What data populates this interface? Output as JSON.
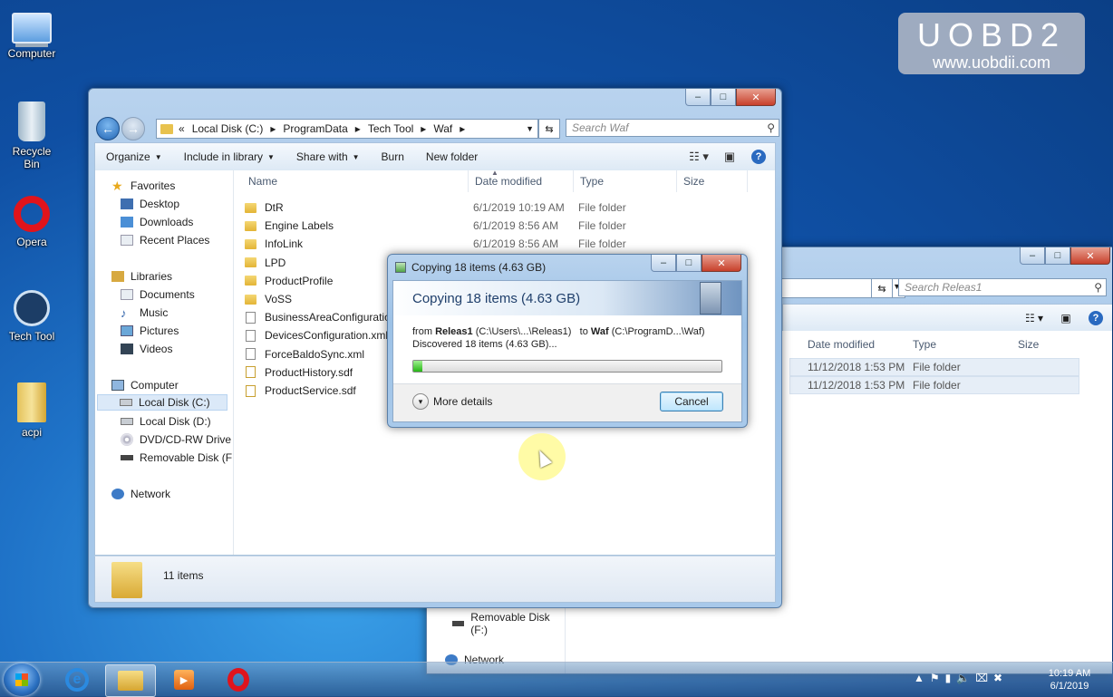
{
  "watermark": {
    "title": "UOBD2",
    "url": "www.uobdii.com"
  },
  "desktop": {
    "icons": [
      "Computer",
      "Recycle Bin",
      "Opera",
      "Tech Tool",
      "acpi"
    ]
  },
  "main_window": {
    "caption_buttons": [
      "–",
      "□",
      "✕"
    ],
    "breadcrumb": [
      "«",
      "Local Disk (C:)",
      "ProgramData",
      "Tech Tool",
      "Waf"
    ],
    "search_placeholder": "Search Waf",
    "toolbar": {
      "organize": "Organize",
      "include": "Include in library",
      "share": "Share with",
      "burn": "Burn",
      "new_folder": "New folder"
    },
    "nav": {
      "favorites": "Favorites",
      "desktop": "Desktop",
      "downloads": "Downloads",
      "recent": "Recent Places",
      "libraries": "Libraries",
      "documents": "Documents",
      "music": "Music",
      "pictures": "Pictures",
      "videos": "Videos",
      "computer": "Computer",
      "local_c": "Local Disk (C:)",
      "local_d": "Local Disk (D:)",
      "dvd": "DVD/CD-RW Drive (",
      "removable": "Removable Disk (F:)",
      "network": "Network"
    },
    "columns": {
      "name": "Name",
      "date": "Date modified",
      "type": "Type",
      "size": "Size"
    },
    "files": [
      {
        "name": "DtR",
        "date": "6/1/2019 10:19 AM",
        "type": "File folder",
        "kind": "folder"
      },
      {
        "name": "Engine Labels",
        "date": "6/1/2019 8:56 AM",
        "type": "File folder",
        "kind": "folder"
      },
      {
        "name": "InfoLink",
        "date": "6/1/2019 8:56 AM",
        "type": "File folder",
        "kind": "folder"
      },
      {
        "name": "LPD",
        "date": "",
        "type": "",
        "kind": "folder"
      },
      {
        "name": "ProductProfile",
        "date": "",
        "type": "",
        "kind": "folder"
      },
      {
        "name": "VoSS",
        "date": "",
        "type": "",
        "kind": "folder"
      },
      {
        "name": "BusinessAreaConfiguration",
        "date": "",
        "type": "",
        "kind": "file"
      },
      {
        "name": "DevicesConfiguration.xml",
        "date": "",
        "type": "",
        "kind": "file"
      },
      {
        "name": "ForceBaldoSync.xml",
        "date": "",
        "type": "",
        "kind": "file"
      },
      {
        "name": "ProductHistory.sdf",
        "date": "",
        "type": "",
        "kind": "sdf"
      },
      {
        "name": "ProductService.sdf",
        "date": "",
        "type": "",
        "kind": "sdf"
      }
    ],
    "status": "11 items"
  },
  "background_window": {
    "search_placeholder": "Search Releas1",
    "columns": {
      "date": "Date modified",
      "type": "Type",
      "size": "Size"
    },
    "rows": [
      {
        "date": "11/12/2018 1:53 PM",
        "type": "File folder"
      },
      {
        "date": "11/12/2018 1:53 PM",
        "type": "File folder"
      }
    ],
    "nav": {
      "removable": "Removable Disk (F:)",
      "network": "Network"
    }
  },
  "copy_dialog": {
    "title": "Copying 18 items (4.63 GB)",
    "heading": "Copying 18 items (4.63 GB)",
    "from_label": "from",
    "from_name": "Releas1",
    "from_path": "(C:\\Users\\...\\Releas1)",
    "to_label": "to",
    "to_name": "Waf",
    "to_path": "(C:\\ProgramD...\\Waf)",
    "discovered": "Discovered 18 items (4.63 GB)...",
    "progress_fraction": 0.03,
    "more_details": "More details",
    "cancel": "Cancel"
  },
  "taskbar": {
    "time": "10:19 AM",
    "date": "6/1/2019"
  }
}
